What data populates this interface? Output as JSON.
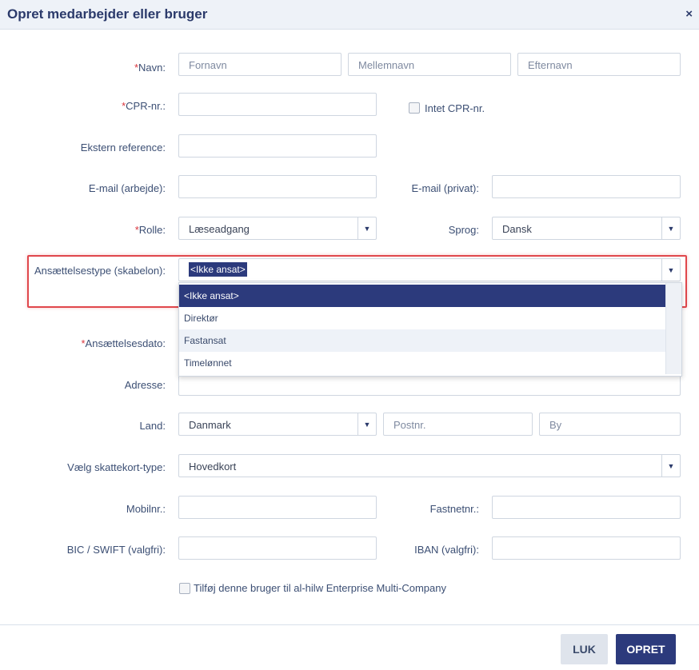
{
  "dialog": {
    "title": "Opret medarbejder eller bruger",
    "close": "×"
  },
  "required_mark": "*",
  "fields": {
    "navn": {
      "label": "Navn:",
      "first_placeholder": "Fornavn",
      "middle_placeholder": "Mellemnavn",
      "last_placeholder": "Efternavn"
    },
    "cpr": {
      "label": "CPR-nr.:",
      "value": "",
      "no_cpr_label": "Intet CPR-nr."
    },
    "ekstern": {
      "label": "Ekstern reference:",
      "value": ""
    },
    "email_work": {
      "label": "E-mail (arbejde):",
      "value": ""
    },
    "email_private": {
      "label": "E-mail (privat):",
      "value": ""
    },
    "rolle": {
      "label": "Rolle:",
      "value": "Læseadgang"
    },
    "sprog": {
      "label": "Sprog:",
      "value": "Dansk"
    },
    "ansaettelsestype": {
      "label": "Ansættelsestype (skabelon):",
      "value": "<Ikke ansat>",
      "options": [
        "<Ikke ansat>",
        "Direktør",
        "Fastansat",
        "Timelønnet"
      ]
    },
    "ansaettelsesdato": {
      "label": "Ansættelsesdato:"
    },
    "adresse": {
      "label": "Adresse:",
      "value": ""
    },
    "land": {
      "label": "Land:",
      "value": "Danmark",
      "postnr_placeholder": "Postnr.",
      "by_placeholder": "By"
    },
    "skattekort": {
      "label": "Vælg skattekort-type:",
      "value": "Hovedkort"
    },
    "mobil": {
      "label": "Mobilnr.:",
      "value": ""
    },
    "fastnet": {
      "label": "Fastnetnr.:",
      "value": ""
    },
    "bic": {
      "label": "BIC / SWIFT (valgfri):",
      "value": ""
    },
    "iban": {
      "label": "IBAN (valgfri):",
      "value": ""
    },
    "multi_company": {
      "label": "Tilføj denne bruger til al-hilw Enterprise Multi-Company"
    }
  },
  "buttons": {
    "close": "LUK",
    "create": "OPRET"
  },
  "colors": {
    "primary": "#2c3a7c",
    "required": "#d9363e",
    "highlight": "#e0474c"
  }
}
